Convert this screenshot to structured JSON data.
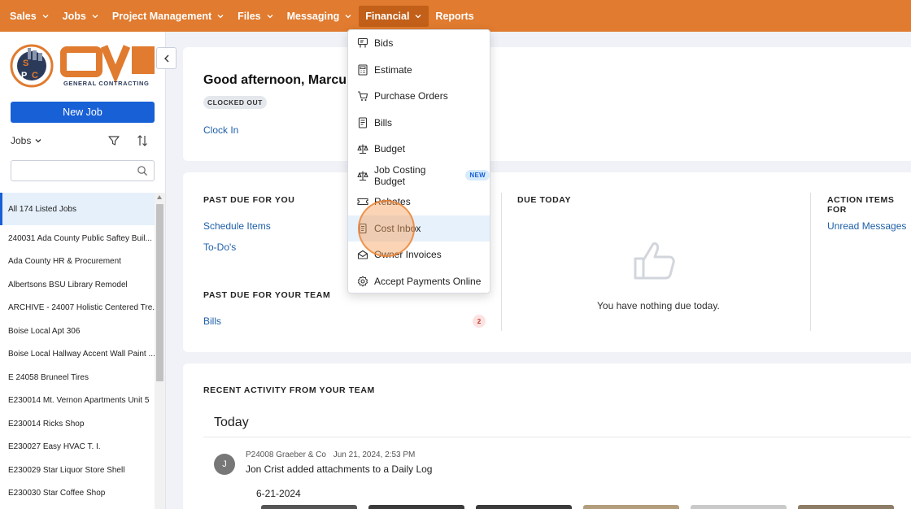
{
  "nav": {
    "items": [
      {
        "label": "Sales",
        "has_chevron": true
      },
      {
        "label": "Jobs",
        "has_chevron": true
      },
      {
        "label": "Project Management",
        "has_chevron": true
      },
      {
        "label": "Files",
        "has_chevron": true
      },
      {
        "label": "Messaging",
        "has_chevron": true
      },
      {
        "label": "Financial",
        "has_chevron": true,
        "active": true
      },
      {
        "label": "Reports",
        "has_chevron": false
      }
    ],
    "bg_color": "#e07b2f"
  },
  "sidebar": {
    "logo_text": "OVI",
    "logo_subtext": "GENERAL CONTRACTING",
    "logo_badge": "SPC",
    "new_job_label": "New Job",
    "jobs_dropdown_label": "Jobs",
    "search_placeholder": "",
    "jobs": [
      "All 174 Listed Jobs",
      "240031 Ada County Public Saftey Buil...",
      "Ada County HR & Procurement",
      "Albertsons BSU Library Remodel",
      "ARCHIVE - 24007 Holistic Centered Tre...",
      "Boise Local Apt 306",
      "Boise Local Hallway Accent Wall Paint ...",
      "E 24058 Bruneel Tires",
      "E230014 Mt. Vernon Apartments Unit 5",
      "E230014 Ricks Shop",
      "E230027 Easy HVAC T. I.",
      "E230029 Star Liquor Store Shell",
      "E230030 Star Coffee Shop"
    ],
    "accent_color": "#1860d6"
  },
  "greeting": {
    "text": "Good afternoon, Marcu",
    "status_badge": "CLOCKED OUT",
    "clock_in_link": "Clock In"
  },
  "due": {
    "past_due_you": {
      "heading": "PAST DUE FOR YOU",
      "links": [
        "Schedule Items",
        "To-Do's"
      ]
    },
    "past_due_team": {
      "heading": "PAST DUE FOR YOUR TEAM",
      "link": "Bills",
      "count": "2"
    },
    "due_today": {
      "heading": "DUE TODAY",
      "empty_text": "You have nothing due today."
    },
    "action_items": {
      "heading": "ACTION ITEMS FOR",
      "link": "Unread Messages"
    }
  },
  "activity": {
    "heading": "RECENT ACTIVITY FROM YOUR TEAM",
    "day": "Today",
    "entry": {
      "avatar_initial": "J",
      "job": "P24008 Graeber & Co",
      "timestamp": "Jun 21, 2024, 2:53 PM",
      "text": "Jon Crist added attachments to a Daily Log",
      "date": "6-21-2024"
    }
  },
  "financial_menu": {
    "items": [
      {
        "label": "Bids",
        "icon": "bids-icon"
      },
      {
        "label": "Estimate",
        "icon": "calculator-icon"
      },
      {
        "label": "Purchase Orders",
        "icon": "cart-icon"
      },
      {
        "label": "Bills",
        "icon": "bill-icon"
      },
      {
        "label": "Budget",
        "icon": "scale-icon"
      },
      {
        "label": "Job Costing Budget",
        "icon": "scale-icon",
        "badge": "NEW"
      },
      {
        "label": "Rebates",
        "icon": "ticket-icon"
      },
      {
        "label": "Cost Inbox",
        "icon": "receipt-icon",
        "highlighted": true
      },
      {
        "label": "Owner Invoices",
        "icon": "invoice-icon"
      },
      {
        "label": "Accept Payments Online",
        "icon": "gear-icon"
      }
    ]
  }
}
